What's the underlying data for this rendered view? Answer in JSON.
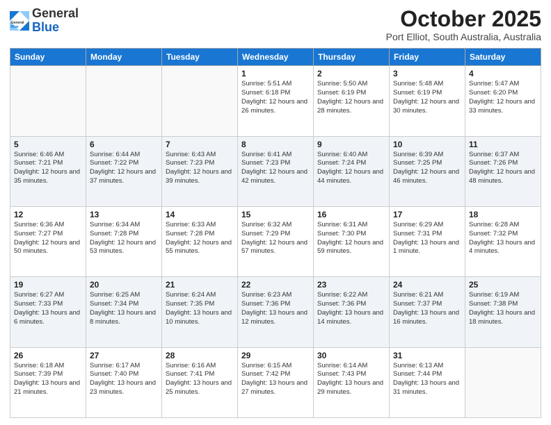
{
  "header": {
    "logo_general": "General",
    "logo_blue": "Blue",
    "month": "October 2025",
    "location": "Port Elliot, South Australia, Australia"
  },
  "weekdays": [
    "Sunday",
    "Monday",
    "Tuesday",
    "Wednesday",
    "Thursday",
    "Friday",
    "Saturday"
  ],
  "weeks": [
    [
      {
        "day": "",
        "info": ""
      },
      {
        "day": "",
        "info": ""
      },
      {
        "day": "",
        "info": ""
      },
      {
        "day": "1",
        "info": "Sunrise: 5:51 AM\nSunset: 6:18 PM\nDaylight: 12 hours\nand 26 minutes."
      },
      {
        "day": "2",
        "info": "Sunrise: 5:50 AM\nSunset: 6:19 PM\nDaylight: 12 hours\nand 28 minutes."
      },
      {
        "day": "3",
        "info": "Sunrise: 5:48 AM\nSunset: 6:19 PM\nDaylight: 12 hours\nand 30 minutes."
      },
      {
        "day": "4",
        "info": "Sunrise: 5:47 AM\nSunset: 6:20 PM\nDaylight: 12 hours\nand 33 minutes."
      }
    ],
    [
      {
        "day": "5",
        "info": "Sunrise: 6:46 AM\nSunset: 7:21 PM\nDaylight: 12 hours\nand 35 minutes."
      },
      {
        "day": "6",
        "info": "Sunrise: 6:44 AM\nSunset: 7:22 PM\nDaylight: 12 hours\nand 37 minutes."
      },
      {
        "day": "7",
        "info": "Sunrise: 6:43 AM\nSunset: 7:23 PM\nDaylight: 12 hours\nand 39 minutes."
      },
      {
        "day": "8",
        "info": "Sunrise: 6:41 AM\nSunset: 7:23 PM\nDaylight: 12 hours\nand 42 minutes."
      },
      {
        "day": "9",
        "info": "Sunrise: 6:40 AM\nSunset: 7:24 PM\nDaylight: 12 hours\nand 44 minutes."
      },
      {
        "day": "10",
        "info": "Sunrise: 6:39 AM\nSunset: 7:25 PM\nDaylight: 12 hours\nand 46 minutes."
      },
      {
        "day": "11",
        "info": "Sunrise: 6:37 AM\nSunset: 7:26 PM\nDaylight: 12 hours\nand 48 minutes."
      }
    ],
    [
      {
        "day": "12",
        "info": "Sunrise: 6:36 AM\nSunset: 7:27 PM\nDaylight: 12 hours\nand 50 minutes."
      },
      {
        "day": "13",
        "info": "Sunrise: 6:34 AM\nSunset: 7:28 PM\nDaylight: 12 hours\nand 53 minutes."
      },
      {
        "day": "14",
        "info": "Sunrise: 6:33 AM\nSunset: 7:28 PM\nDaylight: 12 hours\nand 55 minutes."
      },
      {
        "day": "15",
        "info": "Sunrise: 6:32 AM\nSunset: 7:29 PM\nDaylight: 12 hours\nand 57 minutes."
      },
      {
        "day": "16",
        "info": "Sunrise: 6:31 AM\nSunset: 7:30 PM\nDaylight: 12 hours\nand 59 minutes."
      },
      {
        "day": "17",
        "info": "Sunrise: 6:29 AM\nSunset: 7:31 PM\nDaylight: 13 hours\nand 1 minute."
      },
      {
        "day": "18",
        "info": "Sunrise: 6:28 AM\nSunset: 7:32 PM\nDaylight: 13 hours\nand 4 minutes."
      }
    ],
    [
      {
        "day": "19",
        "info": "Sunrise: 6:27 AM\nSunset: 7:33 PM\nDaylight: 13 hours\nand 6 minutes."
      },
      {
        "day": "20",
        "info": "Sunrise: 6:25 AM\nSunset: 7:34 PM\nDaylight: 13 hours\nand 8 minutes."
      },
      {
        "day": "21",
        "info": "Sunrise: 6:24 AM\nSunset: 7:35 PM\nDaylight: 13 hours\nand 10 minutes."
      },
      {
        "day": "22",
        "info": "Sunrise: 6:23 AM\nSunset: 7:36 PM\nDaylight: 13 hours\nand 12 minutes."
      },
      {
        "day": "23",
        "info": "Sunrise: 6:22 AM\nSunset: 7:36 PM\nDaylight: 13 hours\nand 14 minutes."
      },
      {
        "day": "24",
        "info": "Sunrise: 6:21 AM\nSunset: 7:37 PM\nDaylight: 13 hours\nand 16 minutes."
      },
      {
        "day": "25",
        "info": "Sunrise: 6:19 AM\nSunset: 7:38 PM\nDaylight: 13 hours\nand 18 minutes."
      }
    ],
    [
      {
        "day": "26",
        "info": "Sunrise: 6:18 AM\nSunset: 7:39 PM\nDaylight: 13 hours\nand 21 minutes."
      },
      {
        "day": "27",
        "info": "Sunrise: 6:17 AM\nSunset: 7:40 PM\nDaylight: 13 hours\nand 23 minutes."
      },
      {
        "day": "28",
        "info": "Sunrise: 6:16 AM\nSunset: 7:41 PM\nDaylight: 13 hours\nand 25 minutes."
      },
      {
        "day": "29",
        "info": "Sunrise: 6:15 AM\nSunset: 7:42 PM\nDaylight: 13 hours\nand 27 minutes."
      },
      {
        "day": "30",
        "info": "Sunrise: 6:14 AM\nSunset: 7:43 PM\nDaylight: 13 hours\nand 29 minutes."
      },
      {
        "day": "31",
        "info": "Sunrise: 6:13 AM\nSunset: 7:44 PM\nDaylight: 13 hours\nand 31 minutes."
      },
      {
        "day": "",
        "info": ""
      }
    ]
  ]
}
